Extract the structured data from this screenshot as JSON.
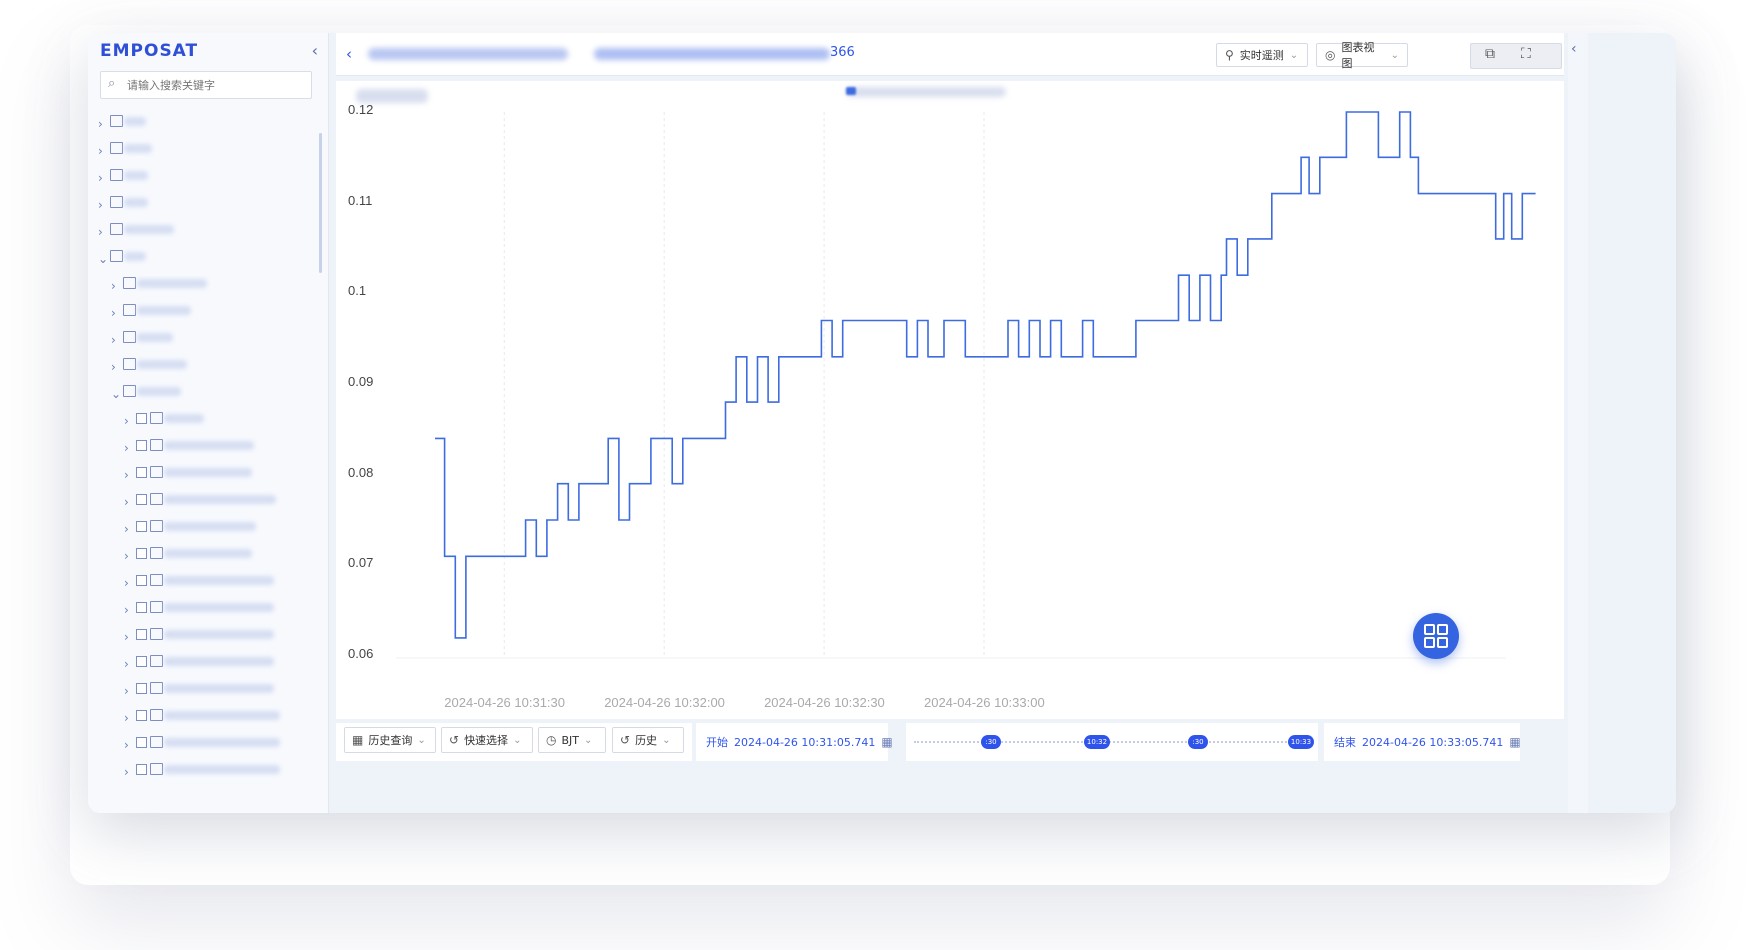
{
  "app": {
    "logo": "EMPOSAT",
    "collapse_icon": "‹"
  },
  "sidebar": {
    "search_placeholder": "请输入搜索关键字",
    "tree_count_top": 6,
    "tree_count_mid": 5,
    "tree_count_leaf": 14
  },
  "header": {
    "crumb_suffix": "366",
    "buttons": [
      {
        "label": "实时遥测",
        "icon": "satellite-icon"
      },
      {
        "label": "图表视图",
        "icon": "chart-view-icon"
      }
    ]
  },
  "toolbar": {
    "history_query": "历史查询",
    "quick_select": "快速选择",
    "timezone": "BJT",
    "history": "历史",
    "start_label": "开始",
    "start_time": "2024-04-26 10:31:05.741",
    "end_label": "结束",
    "end_time": "2024-04-26 10:33:05.741",
    "slider_marks": [
      ":30",
      "10:32",
      ":30",
      "10:33"
    ]
  },
  "chart_data": {
    "type": "line",
    "series": [
      {
        "color": "#3d6be0",
        "points": [
          [
            0.0,
            0.084
          ],
          [
            1.8,
            0.084
          ],
          [
            1.8,
            0.071
          ],
          [
            3.8,
            0.071
          ],
          [
            3.8,
            0.062
          ],
          [
            5.8,
            0.062
          ],
          [
            5.8,
            0.071
          ],
          [
            17.0,
            0.071
          ],
          [
            17.0,
            0.075
          ],
          [
            19.0,
            0.075
          ],
          [
            19.0,
            0.071
          ],
          [
            21.0,
            0.071
          ],
          [
            21.0,
            0.075
          ],
          [
            23.0,
            0.075
          ],
          [
            23.0,
            0.079
          ],
          [
            25.0,
            0.079
          ],
          [
            25.0,
            0.075
          ],
          [
            27.0,
            0.075
          ],
          [
            27.0,
            0.079
          ],
          [
            32.5,
            0.079
          ],
          [
            32.5,
            0.084
          ],
          [
            34.5,
            0.084
          ],
          [
            34.5,
            0.075
          ],
          [
            36.5,
            0.075
          ],
          [
            36.5,
            0.079
          ],
          [
            40.5,
            0.079
          ],
          [
            40.5,
            0.084
          ],
          [
            44.5,
            0.084
          ],
          [
            44.5,
            0.079
          ],
          [
            46.5,
            0.079
          ],
          [
            46.5,
            0.084
          ],
          [
            54.5,
            0.084
          ],
          [
            54.5,
            0.088
          ],
          [
            56.5,
            0.088
          ],
          [
            56.5,
            0.093
          ],
          [
            58.5,
            0.093
          ],
          [
            58.5,
            0.088
          ],
          [
            60.5,
            0.088
          ],
          [
            60.5,
            0.093
          ],
          [
            62.5,
            0.093
          ],
          [
            62.5,
            0.088
          ],
          [
            64.5,
            0.088
          ],
          [
            64.5,
            0.093
          ],
          [
            72.5,
            0.093
          ],
          [
            72.5,
            0.097
          ],
          [
            74.5,
            0.097
          ],
          [
            74.5,
            0.093
          ],
          [
            76.5,
            0.093
          ],
          [
            76.5,
            0.097
          ],
          [
            88.5,
            0.097
          ],
          [
            88.5,
            0.093
          ],
          [
            90.5,
            0.093
          ],
          [
            90.5,
            0.097
          ],
          [
            92.5,
            0.097
          ],
          [
            92.5,
            0.093
          ],
          [
            95.5,
            0.093
          ],
          [
            95.5,
            0.097
          ],
          [
            99.5,
            0.097
          ],
          [
            99.5,
            0.093
          ],
          [
            107.5,
            0.093
          ],
          [
            107.5,
            0.097
          ],
          [
            109.5,
            0.097
          ],
          [
            109.5,
            0.093
          ],
          [
            111.5,
            0.093
          ],
          [
            111.5,
            0.097
          ],
          [
            113.5,
            0.097
          ],
          [
            113.5,
            0.093
          ],
          [
            115.5,
            0.093
          ],
          [
            115.5,
            0.097
          ],
          [
            117.5,
            0.097
          ],
          [
            117.5,
            0.093
          ],
          [
            121.5,
            0.093
          ],
          [
            121.5,
            0.097
          ],
          [
            123.5,
            0.097
          ],
          [
            123.5,
            0.093
          ],
          [
            131.5,
            0.093
          ],
          [
            131.5,
            0.097
          ],
          [
            139.5,
            0.097
          ],
          [
            139.5,
            0.102
          ],
          [
            141.5,
            0.102
          ],
          [
            141.5,
            0.097
          ],
          [
            143.5,
            0.097
          ],
          [
            143.5,
            0.102
          ],
          [
            145.5,
            0.102
          ],
          [
            145.5,
            0.097
          ],
          [
            147.5,
            0.097
          ],
          [
            147.5,
            0.102
          ],
          [
            148.5,
            0.102
          ],
          [
            148.5,
            0.106
          ],
          [
            150.5,
            0.106
          ],
          [
            150.5,
            0.102
          ],
          [
            152.5,
            0.102
          ],
          [
            152.5,
            0.106
          ],
          [
            157.0,
            0.106
          ],
          [
            157.0,
            0.111
          ],
          [
            162.5,
            0.111
          ],
          [
            162.5,
            0.115
          ],
          [
            164.0,
            0.115
          ],
          [
            164.0,
            0.111
          ],
          [
            166.0,
            0.111
          ],
          [
            166.0,
            0.115
          ],
          [
            171.0,
            0.115
          ],
          [
            171.0,
            0.12
          ],
          [
            177.0,
            0.12
          ],
          [
            177.0,
            0.115
          ],
          [
            181.0,
            0.115
          ],
          [
            181.0,
            0.12
          ],
          [
            183.0,
            0.12
          ],
          [
            183.0,
            0.115
          ],
          [
            184.5,
            0.115
          ],
          [
            184.5,
            0.111
          ],
          [
            199.0,
            0.111
          ],
          [
            199.0,
            0.106
          ],
          [
            200.5,
            0.106
          ],
          [
            200.5,
            0.111
          ],
          [
            202.0,
            0.111
          ],
          [
            202.0,
            0.106
          ],
          [
            204.0,
            0.106
          ],
          [
            204.0,
            0.111
          ],
          [
            206.5,
            0.111
          ]
        ]
      }
    ],
    "x_start_offset_s": 0,
    "x_ticks": [
      "2024-04-26 10:31:30",
      "2024-04-26 10:32:00",
      "2024-04-26 10:32:30",
      "2024-04-26 10:33:00"
    ],
    "x_tick_offsets_s": [
      13.0,
      43.0,
      73.0,
      103.0
    ],
    "ylim": [
      0.06,
      0.12
    ],
    "y_ticks": [
      "0.12",
      "0.11",
      "0.1",
      "0.09",
      "0.08",
      "0.07",
      "0.06"
    ],
    "grid": "vertical"
  }
}
